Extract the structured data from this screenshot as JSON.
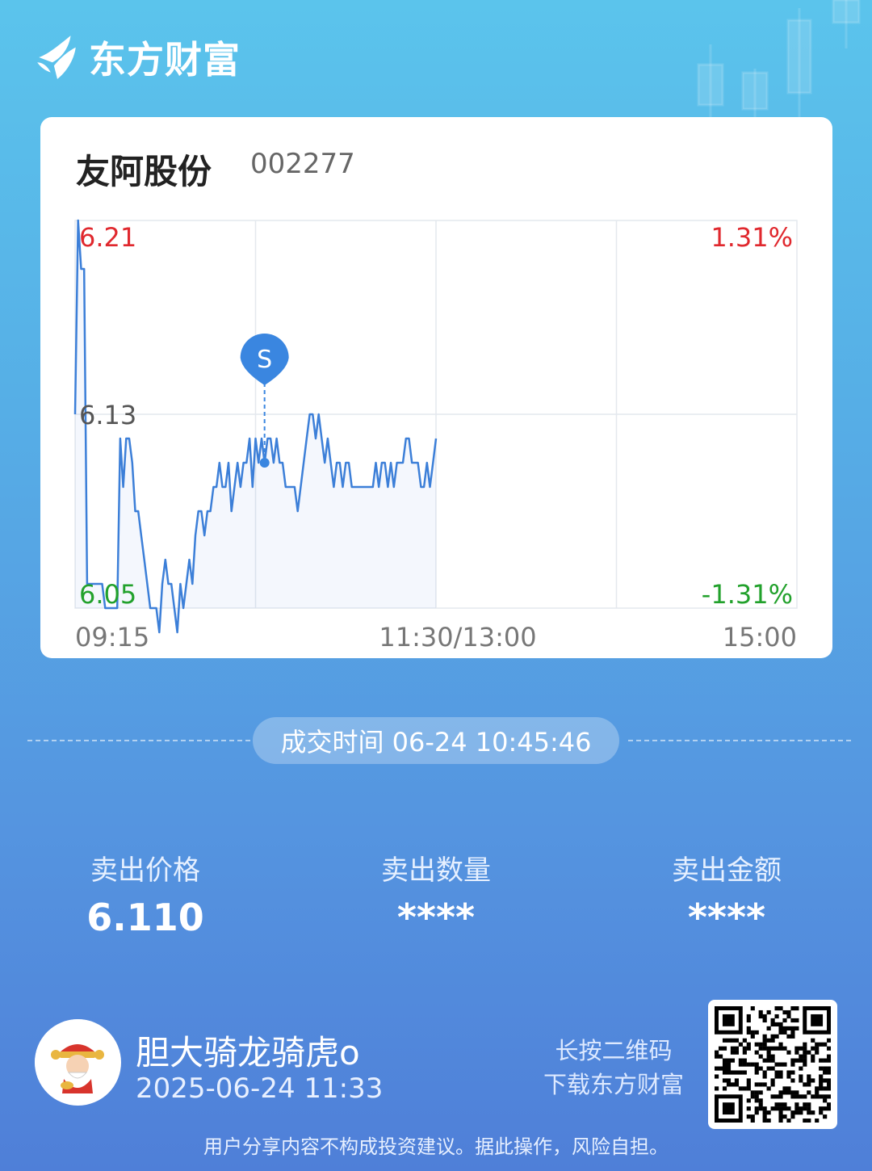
{
  "brand": {
    "name": "东方财富"
  },
  "stock": {
    "name": "友阿股份",
    "code": "002277"
  },
  "chart_data": {
    "type": "line",
    "y_labels": {
      "high": "6.21",
      "mid": "6.13",
      "low": "6.05"
    },
    "pct_labels": {
      "high": "1.31%",
      "low": "-1.31%"
    },
    "x_labels": [
      "09:15",
      "11:30/13:00",
      "15:00"
    ],
    "ylim": [
      6.05,
      6.21
    ],
    "marker": {
      "label": "S",
      "time_index": 63,
      "price": 6.11
    },
    "series": [
      {
        "values": [
          6.13,
          6.21,
          6.19,
          6.19,
          6.06,
          6.06,
          6.06,
          6.06,
          6.06,
          6.06,
          6.05,
          6.05,
          6.05,
          6.05,
          6.05,
          6.12,
          6.1,
          6.12,
          6.12,
          6.11,
          6.09,
          6.09,
          6.08,
          6.07,
          6.06,
          6.05,
          6.05,
          6.05,
          6.04,
          6.06,
          6.07,
          6.06,
          6.06,
          6.05,
          6.04,
          6.06,
          6.05,
          6.06,
          6.07,
          6.06,
          6.08,
          6.09,
          6.09,
          6.08,
          6.09,
          6.09,
          6.1,
          6.1,
          6.11,
          6.1,
          6.1,
          6.11,
          6.09,
          6.1,
          6.11,
          6.1,
          6.11,
          6.11,
          6.12,
          6.1,
          6.12,
          6.11,
          6.12,
          6.11,
          6.12,
          6.12,
          6.11,
          6.12,
          6.11,
          6.11,
          6.1,
          6.1,
          6.1,
          6.1,
          6.09,
          6.1,
          6.11,
          6.12,
          6.13,
          6.13,
          6.12,
          6.13,
          6.12,
          6.11,
          6.12,
          6.11,
          6.1,
          6.11,
          6.11,
          6.1,
          6.11,
          6.11,
          6.1,
          6.1,
          6.1,
          6.1,
          6.1,
          6.1,
          6.1,
          6.1,
          6.11,
          6.1,
          6.11,
          6.11,
          6.1,
          6.11,
          6.1,
          6.11,
          6.11,
          6.11,
          6.12,
          6.12,
          6.11,
          6.11,
          6.11,
          6.1,
          6.1,
          6.11,
          6.1,
          6.11,
          6.12
        ]
      }
    ]
  },
  "trade_time": "成交时间 06-24 10:45:46",
  "stats": [
    {
      "label": "卖出价格",
      "value": "6.110"
    },
    {
      "label": "卖出数量",
      "value": "****"
    },
    {
      "label": "卖出金额",
      "value": "****"
    }
  ],
  "user": {
    "name": "胆大骑龙骑虎o",
    "time": "2025-06-24 11:33"
  },
  "qr_hint": {
    "line1": "长按二维码",
    "line2": "下载东方财富"
  },
  "disclaimer": "用户分享内容不构成投资建议。据此操作，风险自担。",
  "colors": {
    "up": "#e0282e",
    "down": "#22a12c",
    "line": "#3c7fd8",
    "marker": "#3a86e0"
  }
}
